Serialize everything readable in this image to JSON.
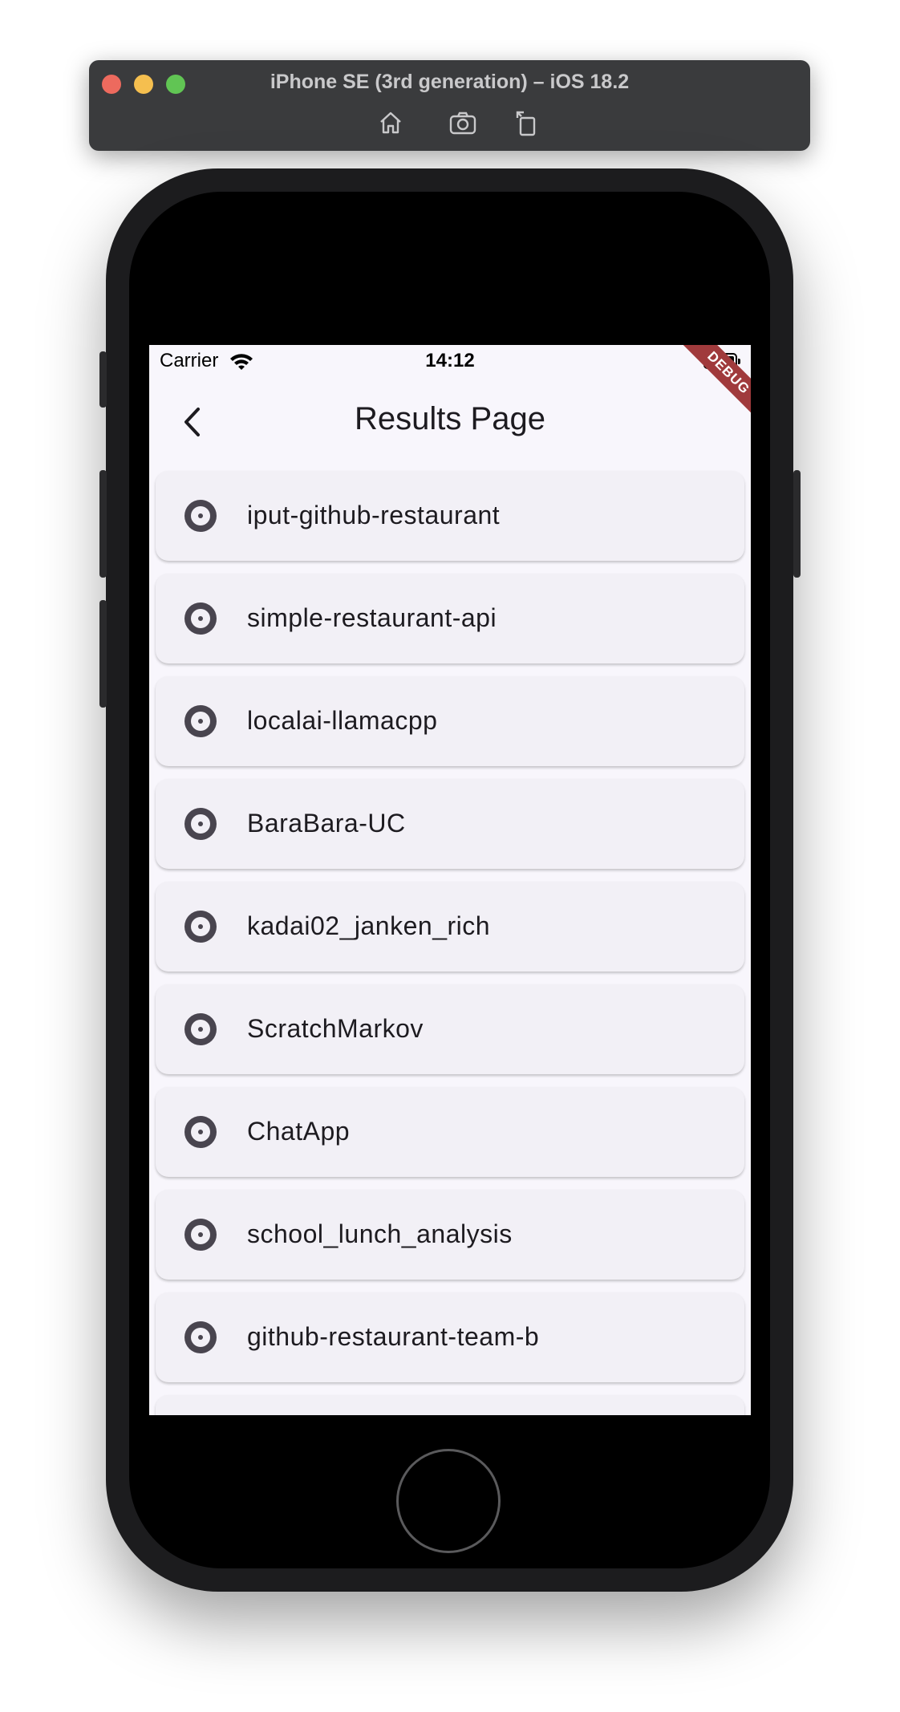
{
  "simulator": {
    "title": "iPhone SE (3rd generation) – iOS 18.2",
    "toolbar": [
      "home-icon",
      "screenshot-icon",
      "rotate-icon"
    ]
  },
  "status_bar": {
    "carrier": "Carrier",
    "time": "14:12"
  },
  "debug_banner": "DEBUG",
  "app_bar": {
    "title": "Results Page",
    "back_icon": "chevron-left-icon"
  },
  "results": [
    {
      "label": "iput-github-restaurant",
      "icon": "disc-icon"
    },
    {
      "label": "simple-restaurant-api",
      "icon": "disc-icon"
    },
    {
      "label": "localai-llamacpp",
      "icon": "disc-icon"
    },
    {
      "label": "BaraBara-UC",
      "icon": "disc-icon"
    },
    {
      "label": "kadai02_janken_rich",
      "icon": "disc-icon"
    },
    {
      "label": "ScratchMarkov",
      "icon": "disc-icon"
    },
    {
      "label": "ChatApp",
      "icon": "disc-icon"
    },
    {
      "label": "school_lunch_analysis",
      "icon": "disc-icon"
    },
    {
      "label": "github-restaurant-team-b",
      "icon": "disc-icon"
    },
    {
      "label": "",
      "icon": "disc-icon"
    }
  ],
  "colors": {
    "screen_background": "#f8f6fc",
    "card_background": "#f2f0f6",
    "icon": "#49454f",
    "debug_banner": "#a03a3c"
  }
}
